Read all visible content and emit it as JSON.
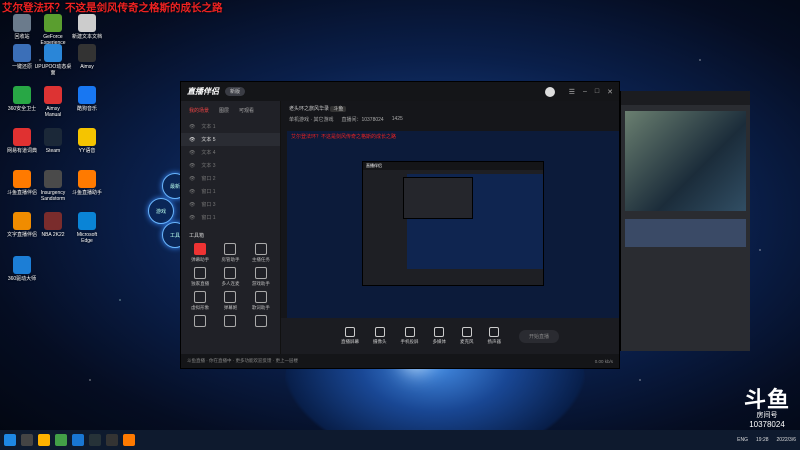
{
  "page_title": "艾尔登法环？不这是剑风传奇之格斯的成长之路",
  "desktop_icons": [
    {
      "label": "回收站",
      "color": "#6b7b8c"
    },
    {
      "label": "GeForce\nExperience",
      "color": "#5a9e2f"
    },
    {
      "label": "新建文本文档",
      "color": "#cccccc"
    },
    {
      "label": "一键还原",
      "color": "#3b6fb8"
    },
    {
      "label": "UPUPOO动态桌面",
      "color": "#2a86d8"
    },
    {
      "label": "Aimsy",
      "color": "#333333"
    },
    {
      "label": "360安全卫士",
      "color": "#28a745"
    },
    {
      "label": "Aimsy\nManual",
      "color": "#d33"
    },
    {
      "label": "酷狗音乐",
      "color": "#1877f2"
    },
    {
      "label": "网易有道词典",
      "color": "#e03131"
    },
    {
      "label": "Steam",
      "color": "#1b2838"
    },
    {
      "label": "YY语音",
      "color": "#f5c400"
    },
    {
      "label": "斗鱼直播伴侣",
      "color": "#ff7a00"
    },
    {
      "label": "Insurgency\nSandstorm",
      "color": "#4a4a4a"
    },
    {
      "label": "斗鱼直播助手",
      "color": "#ff7a00"
    },
    {
      "label": "文字直播伴侣",
      "color": "#f08c00"
    },
    {
      "label": "NBA 2K22",
      "color": "#7a2c2c"
    },
    {
      "label": "Microsoft\nEdge",
      "color": "#0a84d6"
    },
    {
      "label": "360驱动大师",
      "color": "#1c7ed6"
    }
  ],
  "app": {
    "logo": "直播伴侣",
    "badge": "新版",
    "tabs": [
      "我的场景",
      "图层",
      "可观看"
    ],
    "scenes": [
      "文本 1",
      "文本 5",
      "文本 4",
      "文本 3",
      "窗口 2",
      "窗口 1",
      "窗口 3",
      "窗口 1"
    ],
    "tools_title": "工具箱",
    "tools": [
      "弹幕助手",
      "房管助手",
      "主播任务",
      "独家直播",
      "多人连麦",
      "游戏助手",
      "虚拟形象",
      "弹幕姬",
      "歌词助手",
      "",
      "",
      ""
    ],
    "room_title": "老头环之旅风华录",
    "room_tag": "斗鱼",
    "room_meta": [
      "单机游戏 · 其它游戏",
      "直播间：10378024",
      "1425"
    ],
    "preview_caption": "艾尔登法环？不这是剑风传奇之格斯的成长之路",
    "bottom_controls": [
      "直播屏幕",
      "摄像头",
      "手机投屏",
      "多媒体",
      "麦克风",
      "扬声器"
    ],
    "start_label": "开始直播",
    "status_left": "斗鱼直播 · 你在直播中 · 更多功能欢迎反馈 · 更上一层楼",
    "status_right": "0.00 kb/s"
  },
  "watermark": {
    "brand": "斗鱼",
    "sub": "房间号",
    "room": "10378024"
  },
  "taskbar": {
    "time": "19:28",
    "date": "2022/3/6",
    "lang": "ENG"
  }
}
